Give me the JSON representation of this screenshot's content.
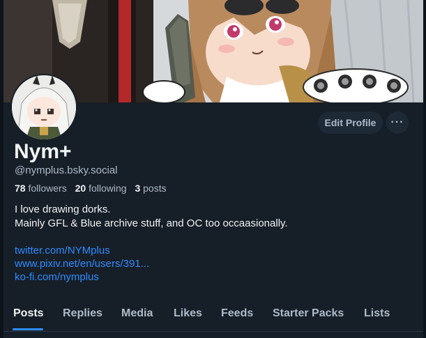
{
  "profile": {
    "display_name": "Nym+",
    "handle": "@nymplus.bsky.social",
    "stats": {
      "followers_count": "78",
      "followers_label": "followers",
      "following_count": "20",
      "following_label": "following",
      "posts_count": "3",
      "posts_label": "posts"
    },
    "bio_lines": [
      "I love drawing dorks.",
      "Mainly GFL & Blue archive stuff, and OC too occaasionally."
    ],
    "links": [
      "twitter.com/NYMplus",
      "www.pixiv.net/en/users/391...",
      "ko-fi.com/nymplus"
    ]
  },
  "actions": {
    "edit_profile_label": "Edit Profile",
    "more_label": "···"
  },
  "tabs": [
    {
      "label": "Posts",
      "active": true
    },
    {
      "label": "Replies",
      "active": false
    },
    {
      "label": "Media",
      "active": false
    },
    {
      "label": "Likes",
      "active": false
    },
    {
      "label": "Feeds",
      "active": false
    },
    {
      "label": "Starter Packs",
      "active": false
    },
    {
      "label": "Lists",
      "active": false
    }
  ],
  "colors": {
    "background": "#161e27",
    "accent": "#2f8cff",
    "muted_text": "#aebbc9",
    "button_bg": "#1e2936"
  }
}
